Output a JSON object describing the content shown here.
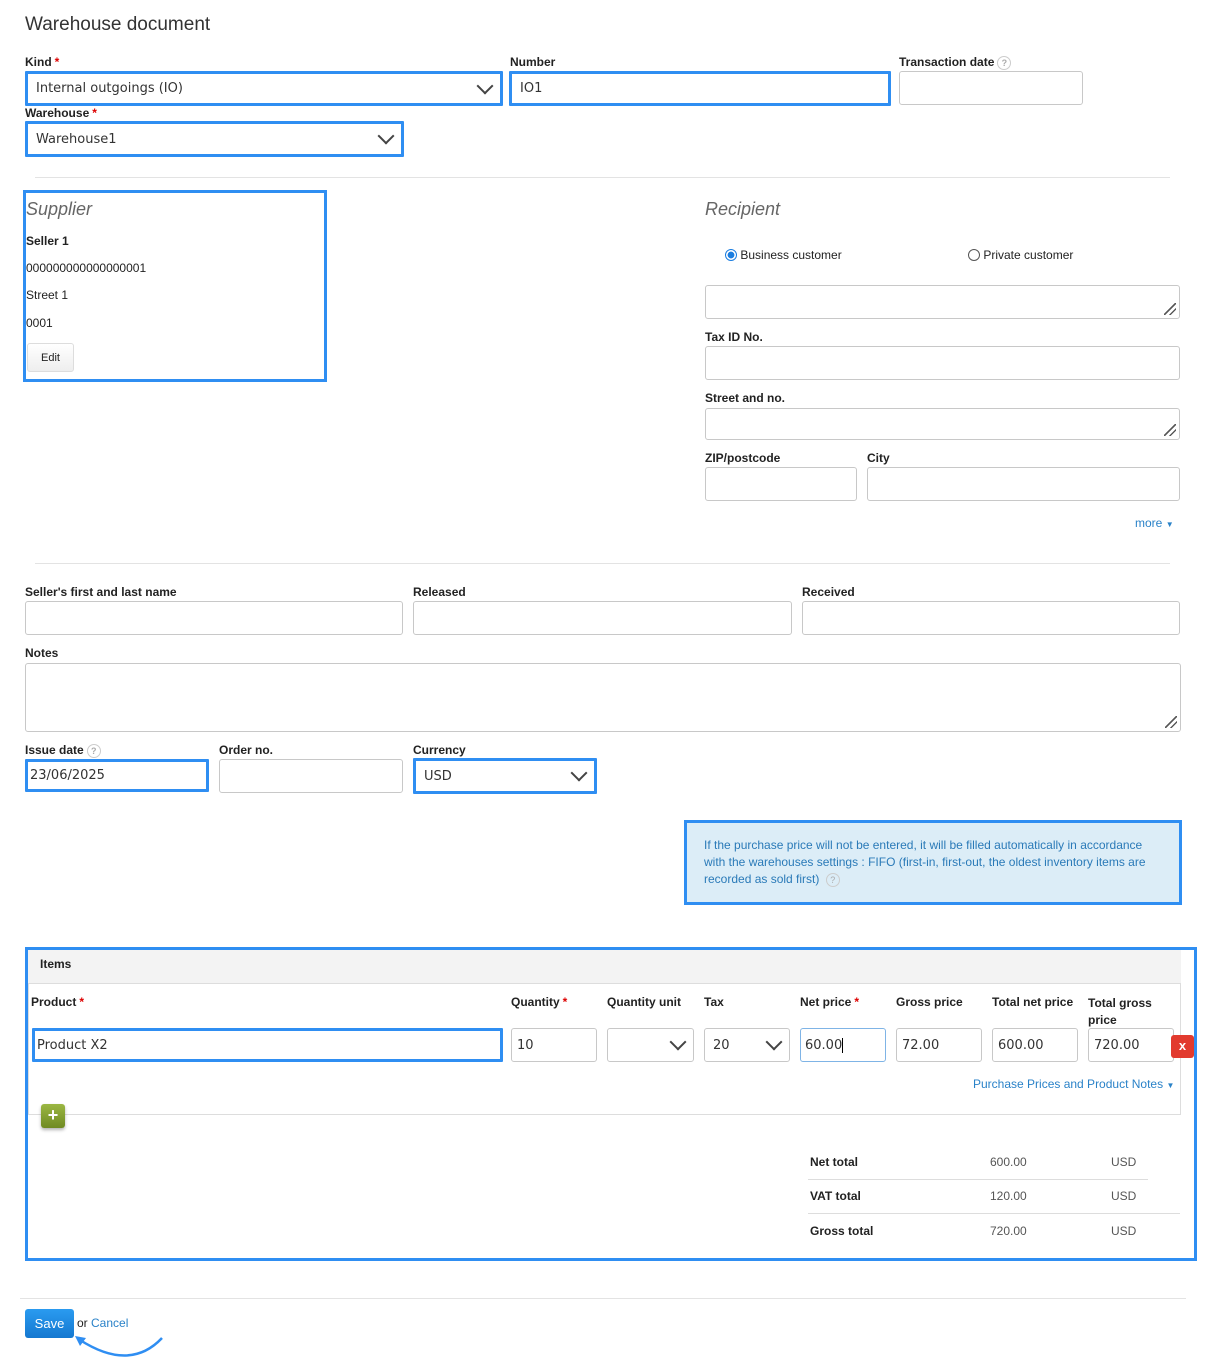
{
  "title": "Warehouse document",
  "header": {
    "kind_label": "Kind",
    "kind_value": "Internal outgoings (IO)",
    "number_label": "Number",
    "number_value": "IO1",
    "transaction_date_label": "Transaction date",
    "transaction_date_value": "",
    "warehouse_label": "Warehouse",
    "warehouse_value": "Warehouse1",
    "help": "?"
  },
  "supplier": {
    "title": "Supplier",
    "name": "Seller 1",
    "tax_id": "000000000000000001",
    "street": "Street 1",
    "zip": "0001",
    "edit_label": "Edit"
  },
  "recipient": {
    "title": "Recipient",
    "radio_business": "Business customer",
    "radio_private": "Private customer",
    "selected": "business",
    "tax_id_label": "Tax ID No.",
    "street_label": "Street and no.",
    "zip_label": "ZIP/postcode",
    "city_label": "City",
    "more_label": "more"
  },
  "people": {
    "seller_name_label": "Seller's first and last name",
    "released_label": "Released",
    "received_label": "Received",
    "notes_label": "Notes"
  },
  "dates": {
    "issue_date_label": "Issue date",
    "issue_date_value": "23/06/2025",
    "order_no_label": "Order no.",
    "currency_label": "Currency",
    "currency_value": "USD"
  },
  "info": {
    "text": "If the purchase price will not be entered, it will be filled automatically in accordance with the warehouses settings : FIFO (first-in, first-out, the oldest inventory items are recorded as sold first)"
  },
  "items": {
    "title": "Items",
    "columns": {
      "product": "Product",
      "quantity": "Quantity",
      "quantity_unit": "Quantity unit",
      "tax": "Tax",
      "net_price": "Net price",
      "gross_price": "Gross price",
      "total_net": "Total net price",
      "total_gross": "Total gross price"
    },
    "rows": [
      {
        "product": "Product X2",
        "quantity": "10",
        "unit": "",
        "tax": "20",
        "net_price": "60.00",
        "gross_price": "72.00",
        "total_net": "600.00",
        "total_gross": "720.00"
      }
    ],
    "delete_label": "x",
    "purchase_link": "Purchase Prices and Product Notes"
  },
  "totals": [
    {
      "label": "Net total",
      "value": "600.00",
      "currency": "USD"
    },
    {
      "label": "VAT total",
      "value": "120.00",
      "currency": "USD"
    },
    {
      "label": "Gross total",
      "value": "720.00",
      "currency": "USD"
    }
  ],
  "footer": {
    "save_label": "Save",
    "or": "or",
    "cancel_label": "Cancel"
  },
  "colors": {
    "highlight": "#2f8ef2",
    "link": "#2a82c8",
    "save": "#1a8be0",
    "delete": "#e23a2e",
    "add": "#7f9b2c"
  }
}
